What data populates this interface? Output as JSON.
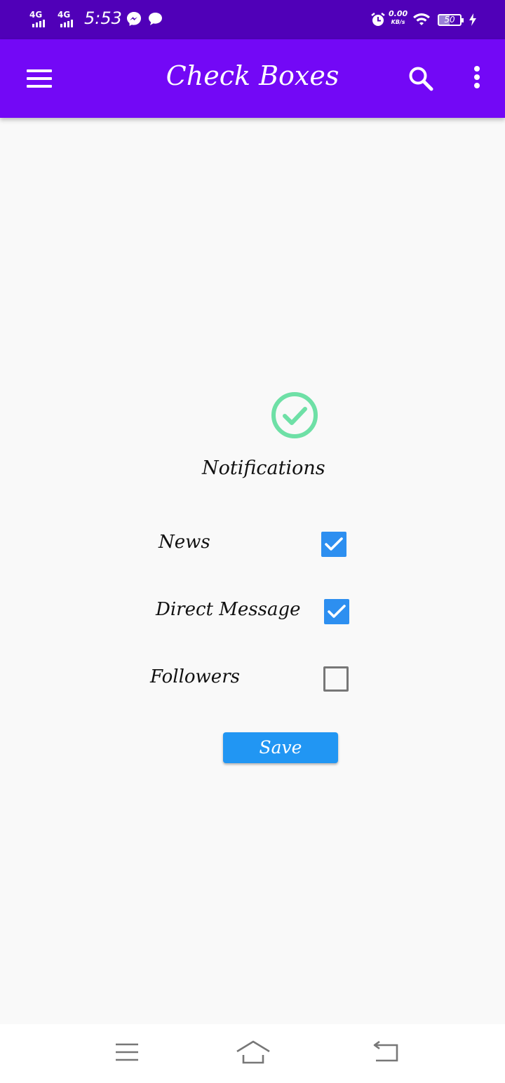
{
  "status_bar": {
    "sim1_label": "4G",
    "sim2_label": "4G",
    "time": "5:53",
    "data_speed_value": "0.00",
    "data_speed_unit": "KB/s",
    "battery_level": "50",
    "icons": [
      "signal-icon",
      "messenger-icon",
      "chat-bubble-icon",
      "alarm-icon",
      "wifi-icon",
      "battery-icon",
      "charging-icon"
    ]
  },
  "app_bar": {
    "title": "Check Boxes",
    "color": "#7308f6",
    "icons": [
      "menu-icon",
      "search-icon",
      "more-vert-icon"
    ]
  },
  "main": {
    "heading_icon": "check-circle-icon",
    "heading_icon_color": "#6ee0a6",
    "heading": "Notifications",
    "options": [
      {
        "label": "News",
        "checked": true
      },
      {
        "label": "Direct Message",
        "checked": true
      },
      {
        "label": "Followers",
        "checked": false
      }
    ],
    "checkbox_color": "#2d8ff0",
    "save_label": "Save",
    "save_color": "#2196f3"
  },
  "nav_bar": {
    "icons": [
      "recents-icon",
      "home-icon",
      "back-icon"
    ]
  }
}
